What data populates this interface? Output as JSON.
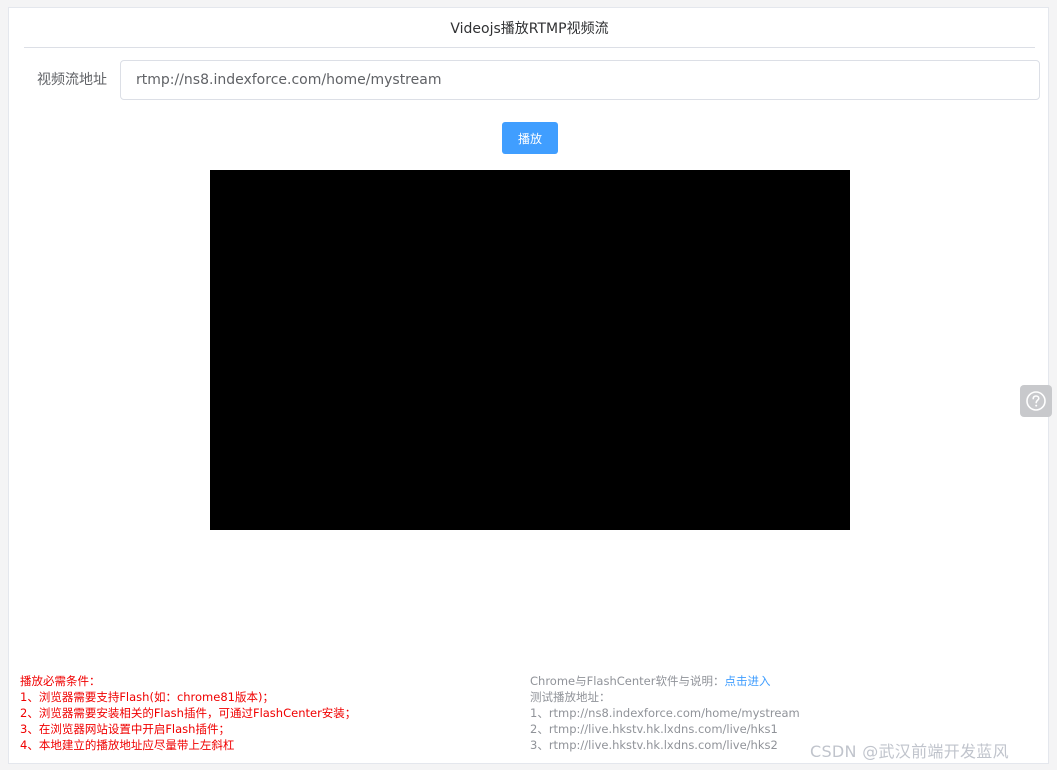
{
  "header": {
    "title": "Videojs播放RTMP视频流"
  },
  "form": {
    "label": "视频流地址",
    "url_value": "rtmp://ns8.indexforce.com/home/mystream"
  },
  "play_button": {
    "label": "播放"
  },
  "requirements": {
    "title": "播放必需条件：",
    "items": [
      "1、浏览器需要支持Flash(如：chrome81版本)；",
      "2、浏览器需要安装相关的Flash插件，可通过FlashCenter安装；",
      "3、在浏览器网站设置中开启Flash插件；",
      "4、本地建立的播放地址应尽量带上左斜杠"
    ]
  },
  "info": {
    "software_text": "Chrome与FlashCenter软件与说明：",
    "software_link": "点击进入",
    "test_title": "测试播放地址：",
    "test_urls": [
      "1、rtmp://ns8.indexforce.com/home/mystream",
      "2、rtmp://live.hkstv.hk.lxdns.com/live/hks1",
      "3、rtmp://live.hkstv.hk.lxdns.com/live/hks2"
    ]
  },
  "watermark": "CSDN @武汉前端开发蓝风",
  "colors": {
    "primary": "#409eff",
    "danger_text": "#f00000",
    "muted_text": "#909399",
    "video_bg": "#000000"
  },
  "icons": {
    "help": "question-circle-icon"
  }
}
